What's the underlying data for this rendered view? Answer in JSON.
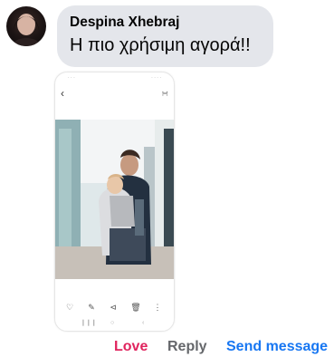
{
  "comment": {
    "author": "Despina Xhebraj",
    "message": "Η πιο χρήσιμη αγορά!!"
  },
  "phone_screenshot": {
    "nav_icons": [
      "back-icon",
      "more-icon"
    ],
    "toolbar_icons": [
      "heart-icon",
      "edit-icon",
      "share-icon",
      "delete-icon",
      "more-vertical-icon"
    ]
  },
  "actions": {
    "love": "Love",
    "reply": "Reply",
    "send_message": "Send message"
  },
  "colors": {
    "love": "#e0245e",
    "reply": "#65676b",
    "send_message": "#1877f2",
    "bubble": "#e4e6eb"
  }
}
